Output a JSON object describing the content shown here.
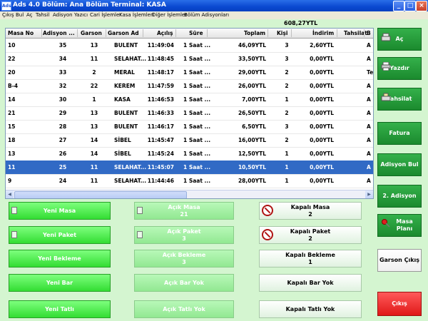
{
  "window": {
    "app_icon": "Ads",
    "title": "Ads 4.0 Bölüm: Ana Bölüm Terminal: KASA"
  },
  "menu": [
    "Çıkış",
    "Bul",
    "Aç",
    "Tahsil",
    "Adisyon",
    "Yazıcı",
    "Cari İşlemler",
    "Kasa İşlemleri",
    "Diğer İşlemler",
    "Bölüm Adisyonları"
  ],
  "total": "608,27YTL",
  "columns": [
    "Masa No",
    "Adisyon ...",
    "Garson",
    "Garson Ad",
    "Açılış",
    "Süre",
    "Toplam",
    "Kişi",
    "İndirim",
    "Tahsilat",
    "B"
  ],
  "rows": [
    [
      "10",
      "35",
      "13",
      "BULENT",
      "11:49:04",
      "1 Saat ...",
      "46,09YTL",
      "3",
      "2,60YTL",
      "A"
    ],
    [
      "22",
      "34",
      "11",
      "SELAHAT...",
      "11:48:45",
      "1 Saat ...",
      "33,50YTL",
      "3",
      "0,00YTL",
      "A"
    ],
    [
      "20",
      "33",
      "2",
      "MERAL",
      "11:48:17",
      "1 Saat ...",
      "29,00YTL",
      "2",
      "0,00YTL",
      "Te"
    ],
    [
      "B-4",
      "32",
      "22",
      "KEREM",
      "11:47:59",
      "1 Saat ...",
      "26,00YTL",
      "2",
      "0,00YTL",
      "A"
    ],
    [
      "14",
      "30",
      "1",
      "KASA",
      "11:46:53",
      "1 Saat ...",
      "7,00YTL",
      "1",
      "0,00YTL",
      "A"
    ],
    [
      "21",
      "29",
      "13",
      "BULENT",
      "11:46:33",
      "1 Saat ...",
      "26,50YTL",
      "2",
      "0,00YTL",
      "A"
    ],
    [
      "15",
      "28",
      "13",
      "BULENT",
      "11:46:17",
      "1 Saat ...",
      "6,50YTL",
      "3",
      "0,00YTL",
      "A"
    ],
    [
      "18",
      "27",
      "14",
      "SİBEL",
      "11:45:47",
      "1 Saat ...",
      "16,00YTL",
      "2",
      "0,00YTL",
      "A"
    ],
    [
      "13",
      "26",
      "14",
      "SİBEL",
      "11:45:24",
      "1 Saat ...",
      "12,50YTL",
      "1",
      "0,00YTL",
      "A"
    ],
    [
      "11",
      "25",
      "11",
      "SELAHAT...",
      "11:45:07",
      "1 Saat ...",
      "10,50YTL",
      "1",
      "0,00YTL",
      "A"
    ],
    [
      "9",
      "24",
      "11",
      "SELAHAT...",
      "11:44:46",
      "1 Saat ...",
      "28,00YTL",
      "1",
      "0,00YTL",
      "A"
    ]
  ],
  "selected_row_index": 9,
  "left_buttons": [
    "Yeni Masa",
    "Yeni Paket",
    "Yeni Bekleme",
    "Yeni Bar",
    "Yeni Tatlı"
  ],
  "mid_buttons": [
    {
      "label": "Açık Masa",
      "count": "21"
    },
    {
      "label": "Açık Paket",
      "count": "3"
    },
    {
      "label": "Açık Bekleme",
      "count": "3"
    },
    {
      "label": "Açık Bar Yok"
    },
    {
      "label": "Açık Tatlı Yok"
    }
  ],
  "closed_buttons": [
    {
      "label": "Kapalı Masa",
      "count": "2"
    },
    {
      "label": "Kapalı Paket",
      "count": "2"
    },
    {
      "label": "Kapalı Bekleme",
      "count": "1"
    },
    {
      "label": "Kapalı Bar Yok"
    },
    {
      "label": "Kapalı Tatlı Yok"
    }
  ],
  "side_buttons": [
    "Aç",
    "Yazdır",
    "Tahsilat",
    "Fatura",
    "Adisyon Bul",
    "2. Adisyon",
    "Masa Planı"
  ],
  "garson_cikis": "Garson Çıkış",
  "cikis": "Çıkış",
  "colors": {
    "title": "#0a48d0",
    "selected_row": "#316ac5",
    "bright_green": "#33dd33",
    "dark_green": "#1b8a2e",
    "red": "#e01818",
    "bg": "#d4f5d0"
  },
  "icons": [
    "app-icon",
    "minimize-icon",
    "maximize-icon",
    "close-icon",
    "printer-icon",
    "cash-register-icon",
    "pushpin-icon",
    "no-entry-icon",
    "document-icon"
  ]
}
